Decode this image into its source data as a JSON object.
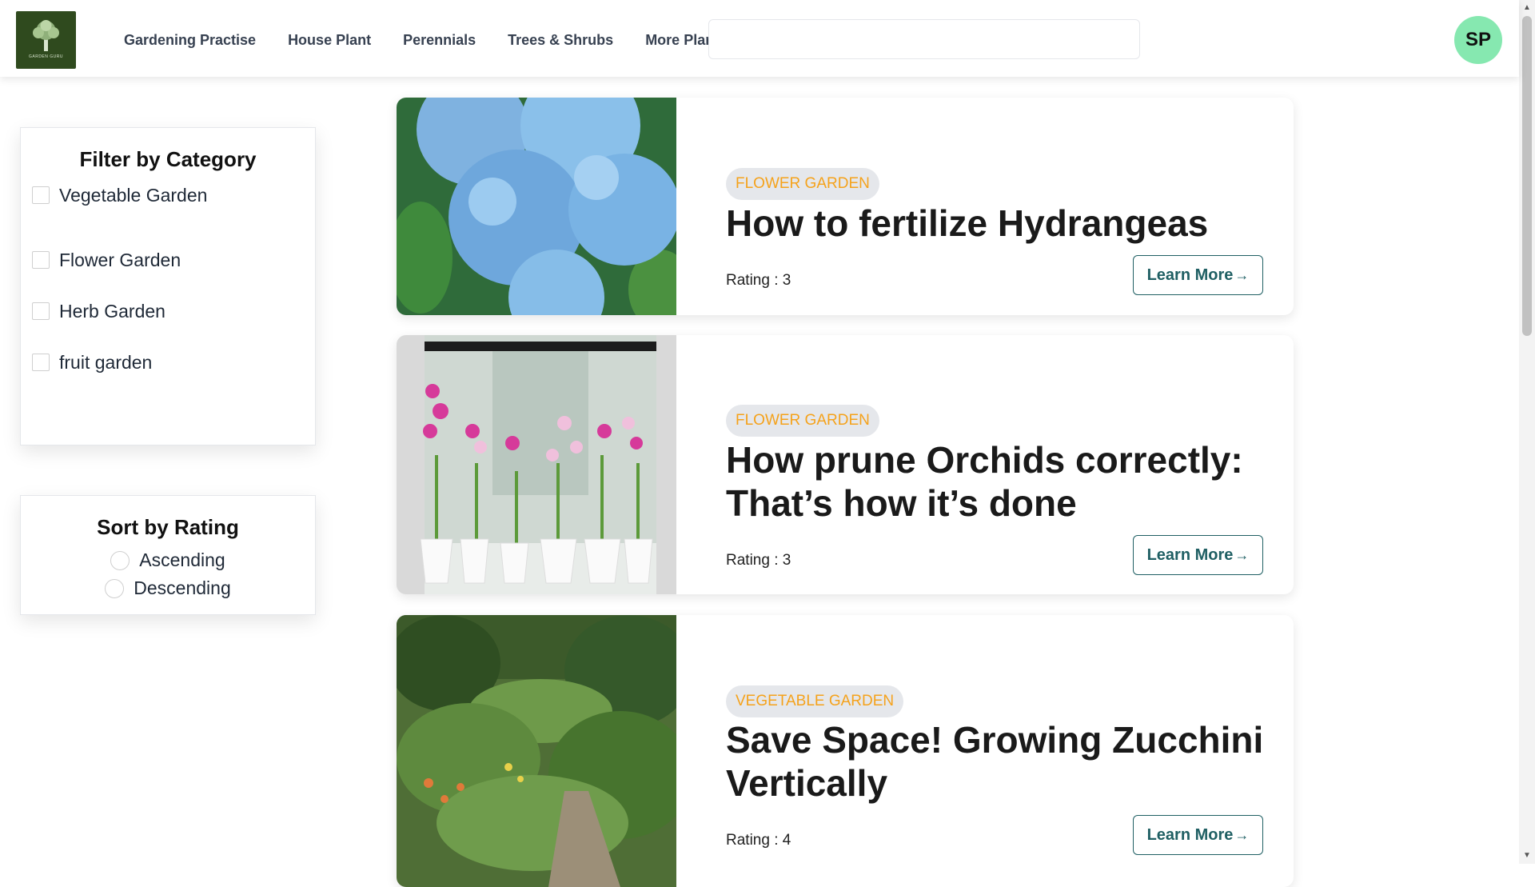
{
  "header": {
    "logo_text": "GARDEN GURU",
    "nav": [
      "Gardening Practise",
      "House Plant",
      "Perennials",
      "Trees & Shrubs",
      "More Plants"
    ],
    "search_placeholder": "",
    "avatar_initials": "SP"
  },
  "filter": {
    "title": "Filter by Category",
    "categories": [
      "Vegetable Garden",
      "Flower Garden",
      "Herb Garden",
      "fruit garden"
    ]
  },
  "sort": {
    "title": "Sort by Rating",
    "options": [
      "Ascending",
      "Descending"
    ]
  },
  "articles": [
    {
      "tag": "Flower Garden",
      "title": "How to fertilize Hydrangeas",
      "rating": "Rating : 3",
      "button": "Learn More",
      "image_icon": "hydrangea-image"
    },
    {
      "tag": "Flower Garden",
      "title": "How prune Orchids correctly: That’s how it’s done",
      "rating": "Rating : 3",
      "button": "Learn More",
      "image_icon": "orchid-image"
    },
    {
      "tag": "Vegetable Garden",
      "title": "Save Space! Growing Zucchini Vertically",
      "rating": "Rating : 4",
      "button": "Learn More",
      "image_icon": "garden-image"
    }
  ],
  "colors": {
    "tag_text": "#f5a21b",
    "button_text": "#1f5f63",
    "avatar_bg": "#86e8b0",
    "logo_bg": "#2f4a1e"
  }
}
